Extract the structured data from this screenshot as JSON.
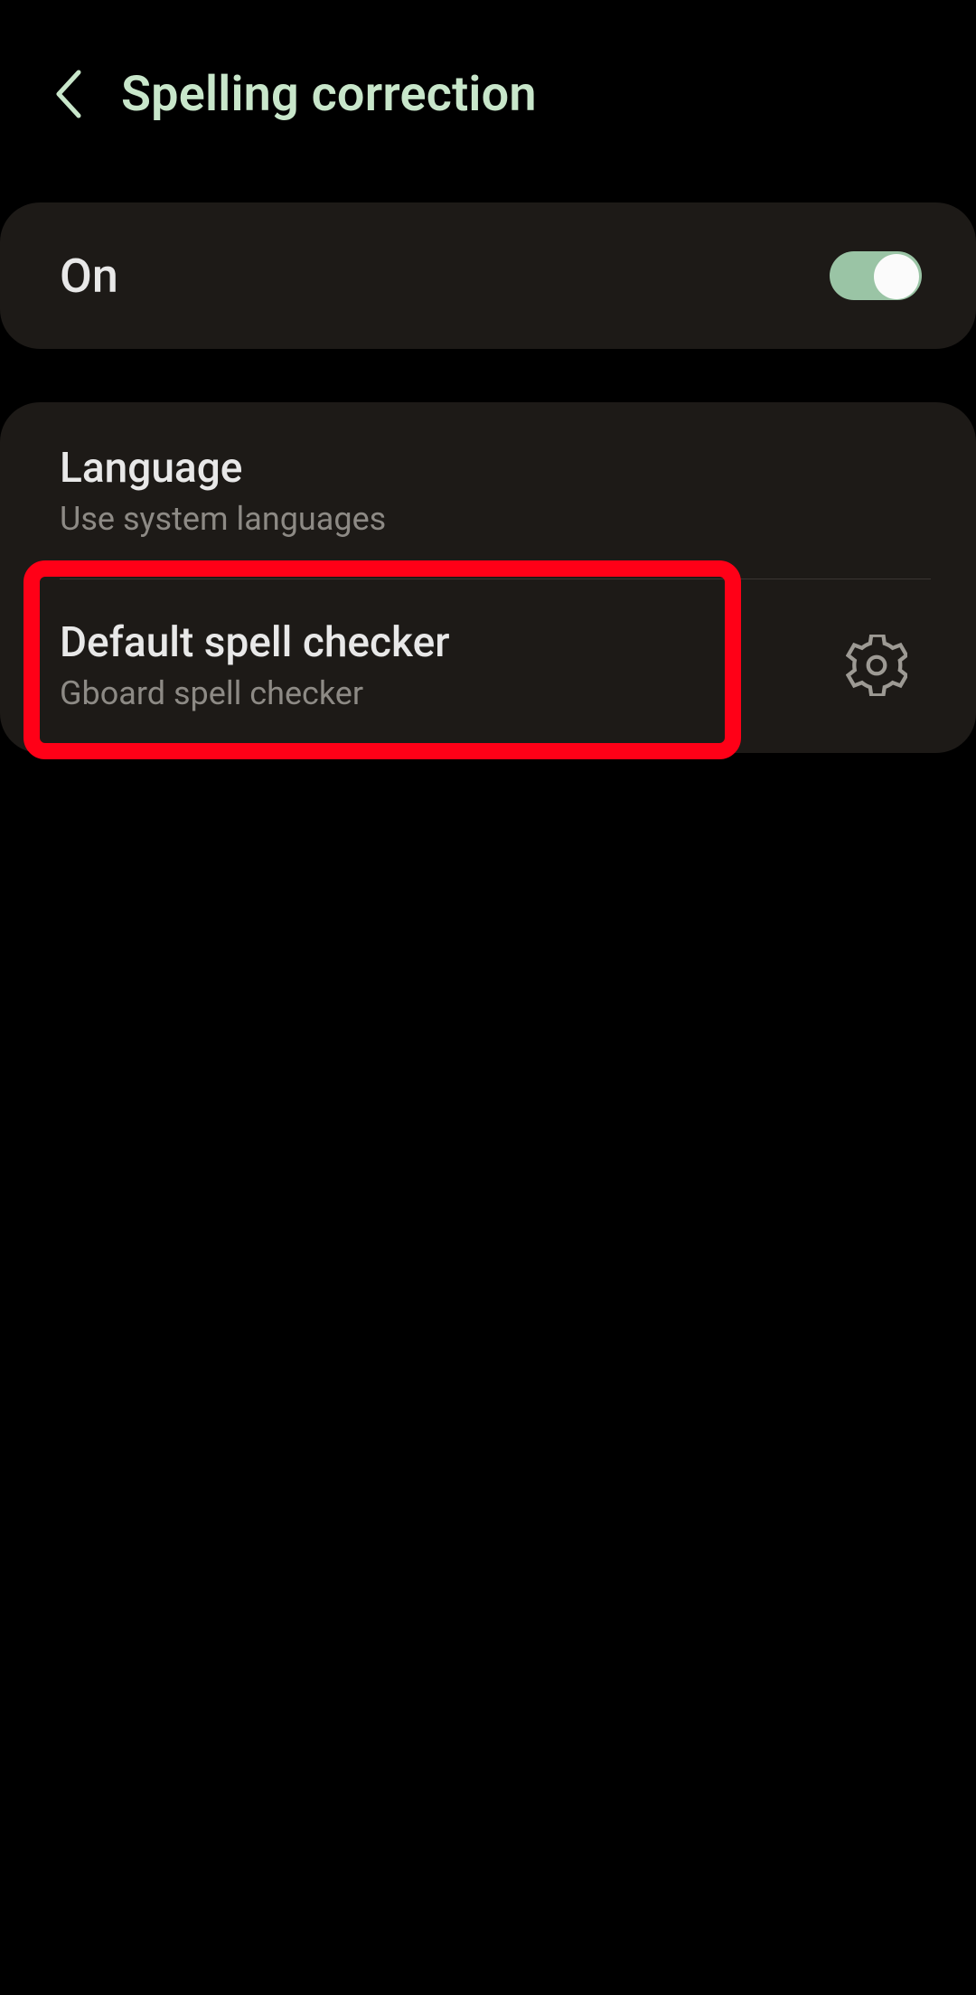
{
  "header": {
    "title": "Spelling correction"
  },
  "toggle": {
    "label": "On",
    "state": "on"
  },
  "language": {
    "title": "Language",
    "subtitle": "Use system languages"
  },
  "default_checker": {
    "title": "Default spell checker",
    "subtitle": "Gboard spell checker"
  }
}
